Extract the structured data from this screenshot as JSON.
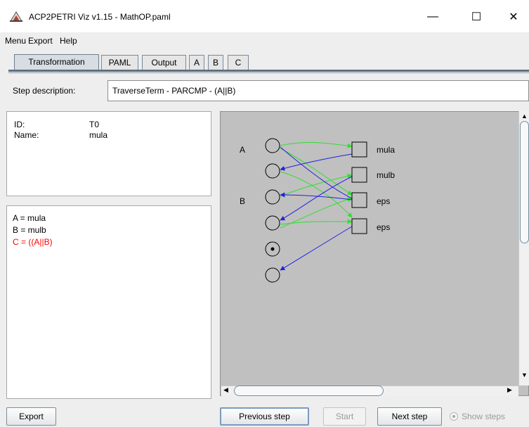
{
  "window": {
    "title": "ACP2PETRI Viz v1.15 - MathOP.paml",
    "minimize": "—",
    "maximize": "☐",
    "close": "✕"
  },
  "menu": [
    "Menu",
    "Export",
    "Help"
  ],
  "tabs": [
    "Transformation",
    "PAML",
    "Output",
    "A",
    "B",
    "C"
  ],
  "step": {
    "label": "Step description:",
    "value": "TraverseTerm - PARCMP - (A||B)"
  },
  "info": {
    "id_label": "ID:",
    "id_value": "T0",
    "name_label": "Name:",
    "name_value": "mula"
  },
  "equations": [
    {
      "text": "A = mula",
      "color": "#000000"
    },
    {
      "text": "B = mulb",
      "color": "#000000"
    },
    {
      "text": "C = ((A||B)",
      "color": "#ff0000"
    }
  ],
  "graph": {
    "place_labels": [
      "A",
      "B"
    ],
    "transition_labels": [
      "mula",
      "mulb",
      "eps",
      "eps"
    ],
    "colors": {
      "green": "#33dd33",
      "blue": "#2222dd"
    }
  },
  "buttons": {
    "export": "Export",
    "previous": "Previous step",
    "start": "Start",
    "next": "Next step",
    "show_steps": "Show steps"
  }
}
